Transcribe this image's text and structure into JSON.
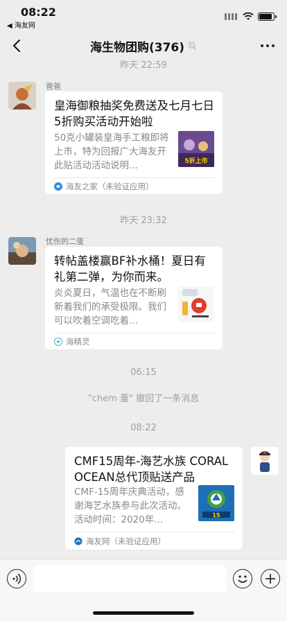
{
  "status_bar": {
    "time": "08:22",
    "back_app": "◀ 海友网"
  },
  "nav": {
    "title": "海生物团购(376)"
  },
  "messages": {
    "ts1": "昨天 22:59",
    "m1": {
      "sender": "爸爸",
      "title": "皇海御粮抽奖免费送及七月七日5折购买活动开始啦",
      "desc": "50克小罐装皇海手工粮即将上市，特为回报广大海友开此贴活动活动说明...",
      "thumb_text": "5折上市",
      "source": "海友之家（未验证应用）"
    },
    "ts2": "昨天 23:32",
    "m2": {
      "sender": "忧伤的二蛋",
      "title": "转帖盖楼赢BF补水桶！夏日有礼第二弹，为你而来。",
      "desc": "炎炎夏日，气温也在不断刷新着我们的承受极限。我们可以吹着空调吃着...",
      "source": "海精灵"
    },
    "ts3": "06:15",
    "recall": "\"chem 董\" 撤回了一条消息",
    "ts4": "08:22",
    "m3": {
      "title": "CMF15周年-海艺水族 CORAL OCEAN总代顶贴送产品",
      "desc": "CMF-15周年庆典活动，感谢海艺水族参与此次活动。活动时间：2020年...",
      "source": "海友网（未验证应用）"
    }
  },
  "icons": [
    "back-arrow-icon",
    "mute-bell-icon",
    "more-icon",
    "voice-icon",
    "emoji-icon",
    "plus-icon"
  ]
}
